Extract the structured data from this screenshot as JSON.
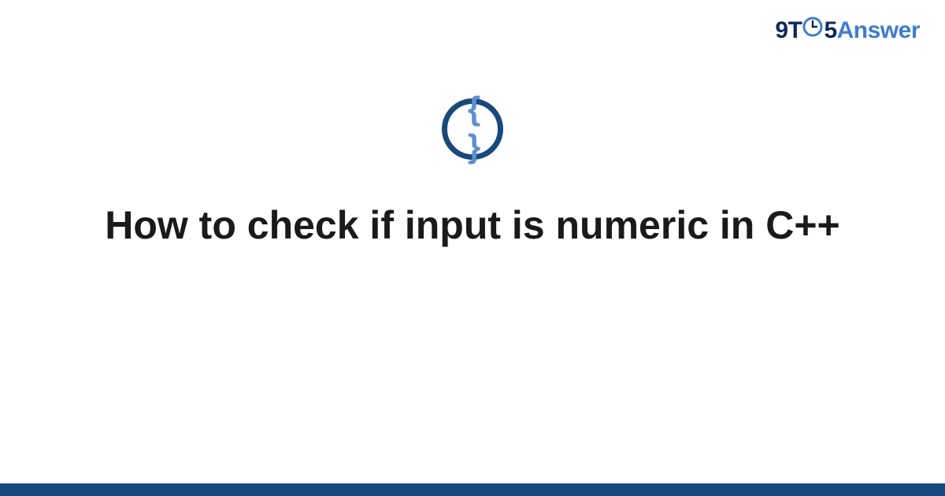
{
  "logo": {
    "nine": "9",
    "t": "T",
    "five": "5",
    "answer": "Answer"
  },
  "icon": {
    "name": "code-braces-icon",
    "braces_text": "{ }"
  },
  "title": "How to check if input is numeric in C++",
  "colors": {
    "dark_blue": "#164a7f",
    "light_blue": "#3b7dd8",
    "navy": "#0e2a5c"
  }
}
